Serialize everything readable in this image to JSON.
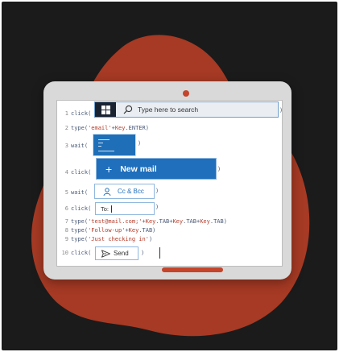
{
  "colors": {
    "background": "#1b1b1b",
    "blob": "#a63a24",
    "device": "#d9d9d9",
    "accent": "#c4452b",
    "outlook_blue": "#1f6fbd"
  },
  "code": {
    "lines": [
      {
        "no": "1",
        "text": "click("
      },
      {
        "no": "2",
        "text": "type('email'+Key.ENTER)"
      },
      {
        "no": "3",
        "text": "wait("
      },
      {
        "no": "4",
        "text": "click("
      },
      {
        "no": "5",
        "text": "wait("
      },
      {
        "no": "6",
        "text": "click("
      },
      {
        "no": "7",
        "text": "type('test@mail.com;'+Key.TAB+Key.TAB+Key.TAB)"
      },
      {
        "no": "8",
        "text": "type('Follow-up'+Key.TAB)"
      },
      {
        "no": "9",
        "text": "type('Just checking in')"
      },
      {
        "no": "10",
        "text": "click("
      }
    ],
    "close_paren": ")"
  },
  "snippets": {
    "search_placeholder": "Type here to search",
    "new_mail_label": "New mail",
    "new_mail_plus": "+",
    "ccbcc_label": "Cc & Bcc",
    "to_label": "To:",
    "send_label": "Send"
  },
  "icons": {
    "windows": "windows-logo-icon",
    "search": "search-icon",
    "person": "person-icon",
    "send": "send-icon"
  }
}
